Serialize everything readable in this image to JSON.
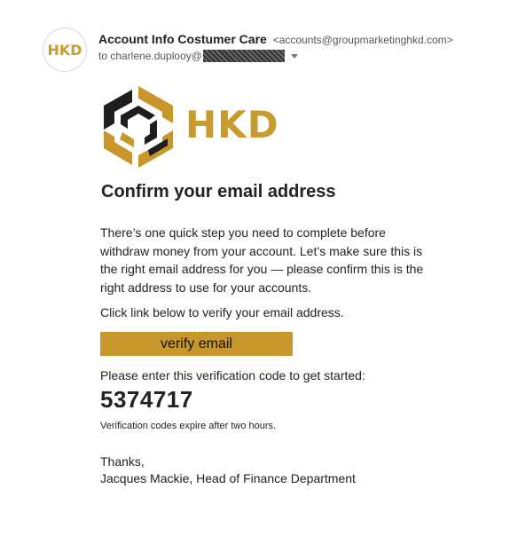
{
  "header": {
    "avatar_text": "HKD",
    "sender_name": "Account Info Costumer Care",
    "sender_email": "<accounts@groupmarketinghkd.com>",
    "recipient_prefix": "to charlene.duplooy@"
  },
  "logo": {
    "wordmark": "HKD"
  },
  "email": {
    "title": "Confirm your email address",
    "body": "There’s one quick step you need to complete before withdraw money from your account. Let’s make sure this is the right email address for you — please confirm this is the right address to use for your accounts.",
    "click_instruction": "Click link below to verify your email address.",
    "verify_button": "verify email",
    "code_label": "Please enter this verification code to get started:",
    "code": "5374717",
    "expire_note": "Verification codes expire after two hours.",
    "thanks": "Thanks,",
    "signature": "Jacques Mackie, Head of Finance Department"
  },
  "colors": {
    "brand_gold": "#c8962a",
    "brand_dark": "#1e1e1e"
  },
  "icons": {
    "logo_mark": "hexagon-swirl-icon",
    "details": "chevron-down-icon"
  }
}
